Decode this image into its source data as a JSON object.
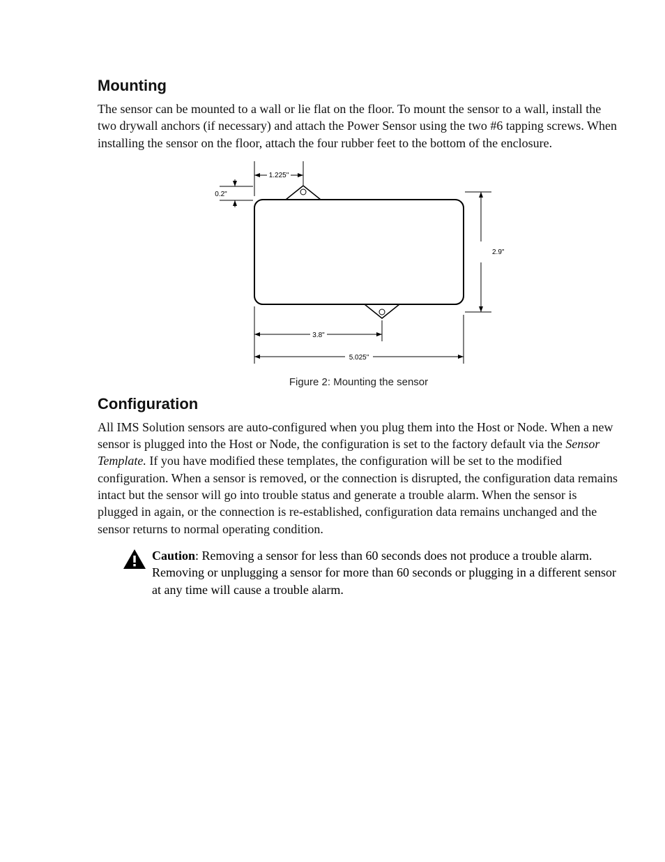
{
  "sections": {
    "mounting": {
      "heading": "Mounting",
      "paragraph": "The sensor can be mounted to a wall or lie flat on the floor. To mount the sensor to a wall, install the two drywall anchors (if necessary) and attach the Power Sensor using the two #6 tapping screws. When installing the sensor on the floor, attach the four rubber feet to the bottom of the enclosure."
    },
    "figure": {
      "caption": "Figure 2: Mounting the sensor",
      "dims": {
        "top_offset": "1.225\"",
        "tab_height": "0.2\"",
        "height": "2.9\"",
        "bottom_offset": "3.8\"",
        "width": "5.025\""
      }
    },
    "configuration": {
      "heading": "Configuration",
      "para_part1": "All IMS Solution sensors are auto-configured when you plug them into the Host or Node.  When a new sensor is plugged into the Host or Node, the configuration is set to the factory default via the ",
      "para_italic": "Sensor Template.",
      "para_part2": "  If you have modified these templates, the configuration will be set to the modified configuration.  When a sensor is removed, or the connection is disrupted, the configuration data remains intact but the sensor will go into trouble status and generate a trouble alarm.  When the sensor is plugged in again, or the connection is re-established, configuration data remains unchanged and the sensor returns to normal operating condition."
    },
    "caution": {
      "label": "Caution",
      "text": ": Removing a sensor for less than 60 seconds does not produce a trouble alarm. Removing or unplugging a sensor for more than 60 seconds or plugging in a different sensor at any time will cause a trouble alarm."
    }
  }
}
